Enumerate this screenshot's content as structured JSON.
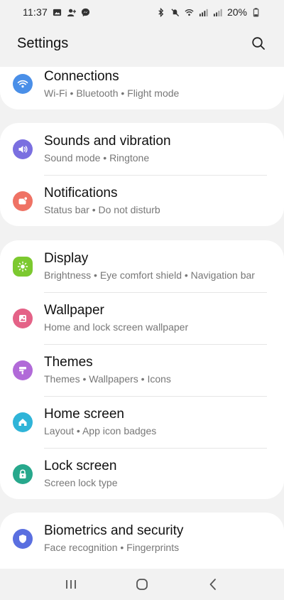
{
  "status_bar": {
    "time": "11:37",
    "battery": "20%"
  },
  "header": {
    "title": "Settings"
  },
  "groups": [
    {
      "items": [
        {
          "title": "Connections",
          "subtitle": "Wi-Fi  •  Bluetooth  •  Flight mode",
          "icon": "wifi-icon",
          "color": "#4a8fe8"
        }
      ]
    },
    {
      "items": [
        {
          "title": "Sounds and vibration",
          "subtitle": "Sound mode  •  Ringtone",
          "icon": "speaker-icon",
          "color": "#7a6fe0"
        },
        {
          "title": "Notifications",
          "subtitle": "Status bar  •  Do not disturb",
          "icon": "notification-icon",
          "color": "#ef7264"
        }
      ]
    },
    {
      "items": [
        {
          "title": "Display",
          "subtitle": "Brightness  •  Eye comfort shield  •  Navigation bar",
          "icon": "sun-icon",
          "color": "#7cc92f"
        },
        {
          "title": "Wallpaper",
          "subtitle": "Home and lock screen wallpaper",
          "icon": "image-icon",
          "color": "#e46287"
        },
        {
          "title": "Themes",
          "subtitle": "Themes  •  Wallpapers  •  Icons",
          "icon": "theme-brush-icon",
          "color": "#b16ad8"
        },
        {
          "title": "Home screen",
          "subtitle": "Layout  •  App icon badges",
          "icon": "home-icon",
          "color": "#2fb4d8"
        },
        {
          "title": "Lock screen",
          "subtitle": "Screen lock type",
          "icon": "lock-icon",
          "color": "#27a88c"
        }
      ]
    },
    {
      "items": [
        {
          "title": "Biometrics and security",
          "subtitle": "Face recognition  •  Fingerprints",
          "icon": "shield-icon",
          "color": "#5a6fe0"
        }
      ]
    }
  ]
}
